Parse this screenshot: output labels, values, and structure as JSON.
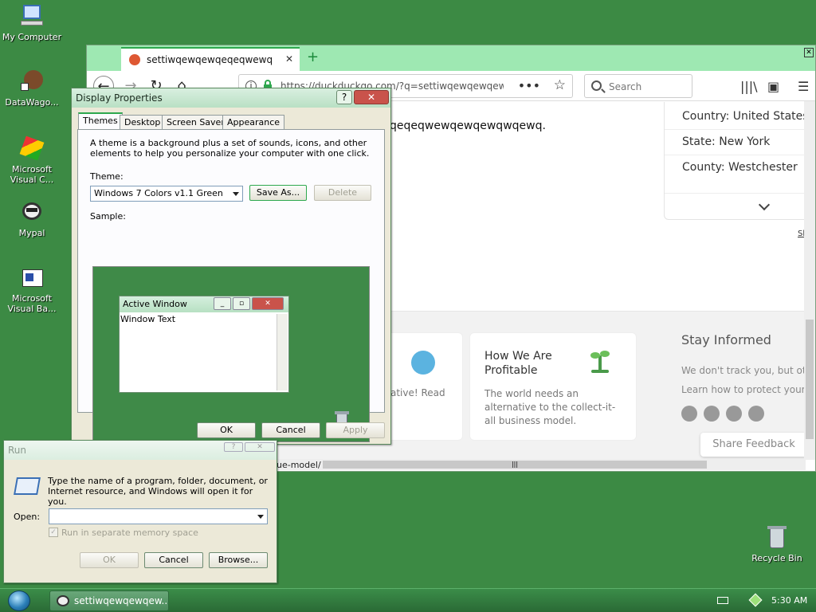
{
  "desktop": {
    "icons": [
      {
        "label": "My Computer"
      },
      {
        "label": "DataWago..."
      },
      {
        "label": "Microsoft Visual C..."
      },
      {
        "label": "Mypal"
      },
      {
        "label": "Microsoft Visual Ba..."
      },
      {
        "label": "Recycle Bin"
      }
    ]
  },
  "browser": {
    "tab_title": "settiwqewqewqeqeqwewq",
    "url": "https://duckduckgo.com/?q=settiwqewqewqewq",
    "search_placeholder": "Search",
    "headline": "qeqeqwewqewqewqwqewq.",
    "info_card": {
      "country_label": "Country:",
      "country_value": "United States",
      "state_label": "State:",
      "state_value": "New York",
      "county_label": "County:",
      "county_value": "Westchester"
    },
    "side_link": "Sh",
    "card_left_text": "ative! Read",
    "card_profitable": {
      "title": "How We Are Profitable",
      "text": "The world needs an alternative to the collect-it-all business model."
    },
    "stay_informed": {
      "title": "Stay Informed",
      "line1": "We don't track you, but other",
      "line2": "Learn how to protect your pr"
    },
    "share_feedback": "Share Feedback",
    "status_url": "ue-model/"
  },
  "display_properties": {
    "title": "Display Properties",
    "tabs": [
      "Themes",
      "Desktop",
      "Screen Saver",
      "Appearance"
    ],
    "description": "A theme is a background plus a set of sounds, icons, and other elements to help you personalize your computer with one click.",
    "theme_label": "Theme:",
    "theme_value": "Windows 7 Colors v1.1 Green",
    "save_as": "Save As...",
    "delete": "Delete",
    "sample_label": "Sample:",
    "active_window": "Active Window",
    "window_text": "Window Text",
    "ok": "OK",
    "cancel": "Cancel",
    "apply": "Apply"
  },
  "run_dialog": {
    "title": "Run",
    "description": "Type the name of a program, folder, document, or Internet resource, and Windows will open it for you.",
    "open_label": "Open:",
    "open_value": "",
    "checkbox_label": "Run in separate memory space",
    "ok": "OK",
    "cancel": "Cancel",
    "browse": "Browse..."
  },
  "taskbar": {
    "task_label": "settiwqewqewqew...",
    "clock": "5:30 AM"
  }
}
